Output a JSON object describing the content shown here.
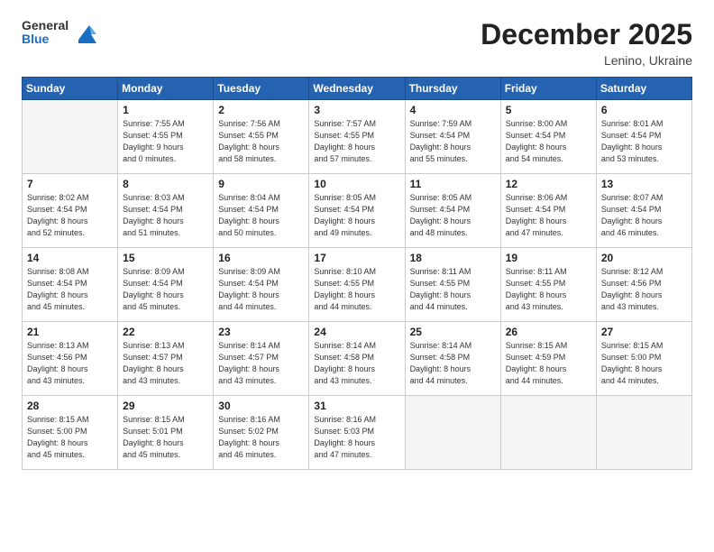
{
  "header": {
    "logo_line1": "General",
    "logo_line2": "Blue",
    "title": "December 2025",
    "location": "Lenino, Ukraine"
  },
  "weekdays": [
    "Sunday",
    "Monday",
    "Tuesday",
    "Wednesday",
    "Thursday",
    "Friday",
    "Saturday"
  ],
  "weeks": [
    [
      {
        "day": "",
        "info": ""
      },
      {
        "day": "1",
        "info": "Sunrise: 7:55 AM\nSunset: 4:55 PM\nDaylight: 9 hours\nand 0 minutes."
      },
      {
        "day": "2",
        "info": "Sunrise: 7:56 AM\nSunset: 4:55 PM\nDaylight: 8 hours\nand 58 minutes."
      },
      {
        "day": "3",
        "info": "Sunrise: 7:57 AM\nSunset: 4:55 PM\nDaylight: 8 hours\nand 57 minutes."
      },
      {
        "day": "4",
        "info": "Sunrise: 7:59 AM\nSunset: 4:54 PM\nDaylight: 8 hours\nand 55 minutes."
      },
      {
        "day": "5",
        "info": "Sunrise: 8:00 AM\nSunset: 4:54 PM\nDaylight: 8 hours\nand 54 minutes."
      },
      {
        "day": "6",
        "info": "Sunrise: 8:01 AM\nSunset: 4:54 PM\nDaylight: 8 hours\nand 53 minutes."
      }
    ],
    [
      {
        "day": "7",
        "info": "Sunrise: 8:02 AM\nSunset: 4:54 PM\nDaylight: 8 hours\nand 52 minutes."
      },
      {
        "day": "8",
        "info": "Sunrise: 8:03 AM\nSunset: 4:54 PM\nDaylight: 8 hours\nand 51 minutes."
      },
      {
        "day": "9",
        "info": "Sunrise: 8:04 AM\nSunset: 4:54 PM\nDaylight: 8 hours\nand 50 minutes."
      },
      {
        "day": "10",
        "info": "Sunrise: 8:05 AM\nSunset: 4:54 PM\nDaylight: 8 hours\nand 49 minutes."
      },
      {
        "day": "11",
        "info": "Sunrise: 8:05 AM\nSunset: 4:54 PM\nDaylight: 8 hours\nand 48 minutes."
      },
      {
        "day": "12",
        "info": "Sunrise: 8:06 AM\nSunset: 4:54 PM\nDaylight: 8 hours\nand 47 minutes."
      },
      {
        "day": "13",
        "info": "Sunrise: 8:07 AM\nSunset: 4:54 PM\nDaylight: 8 hours\nand 46 minutes."
      }
    ],
    [
      {
        "day": "14",
        "info": "Sunrise: 8:08 AM\nSunset: 4:54 PM\nDaylight: 8 hours\nand 45 minutes."
      },
      {
        "day": "15",
        "info": "Sunrise: 8:09 AM\nSunset: 4:54 PM\nDaylight: 8 hours\nand 45 minutes."
      },
      {
        "day": "16",
        "info": "Sunrise: 8:09 AM\nSunset: 4:54 PM\nDaylight: 8 hours\nand 44 minutes."
      },
      {
        "day": "17",
        "info": "Sunrise: 8:10 AM\nSunset: 4:55 PM\nDaylight: 8 hours\nand 44 minutes."
      },
      {
        "day": "18",
        "info": "Sunrise: 8:11 AM\nSunset: 4:55 PM\nDaylight: 8 hours\nand 44 minutes."
      },
      {
        "day": "19",
        "info": "Sunrise: 8:11 AM\nSunset: 4:55 PM\nDaylight: 8 hours\nand 43 minutes."
      },
      {
        "day": "20",
        "info": "Sunrise: 8:12 AM\nSunset: 4:56 PM\nDaylight: 8 hours\nand 43 minutes."
      }
    ],
    [
      {
        "day": "21",
        "info": "Sunrise: 8:13 AM\nSunset: 4:56 PM\nDaylight: 8 hours\nand 43 minutes."
      },
      {
        "day": "22",
        "info": "Sunrise: 8:13 AM\nSunset: 4:57 PM\nDaylight: 8 hours\nand 43 minutes."
      },
      {
        "day": "23",
        "info": "Sunrise: 8:14 AM\nSunset: 4:57 PM\nDaylight: 8 hours\nand 43 minutes."
      },
      {
        "day": "24",
        "info": "Sunrise: 8:14 AM\nSunset: 4:58 PM\nDaylight: 8 hours\nand 43 minutes."
      },
      {
        "day": "25",
        "info": "Sunrise: 8:14 AM\nSunset: 4:58 PM\nDaylight: 8 hours\nand 44 minutes."
      },
      {
        "day": "26",
        "info": "Sunrise: 8:15 AM\nSunset: 4:59 PM\nDaylight: 8 hours\nand 44 minutes."
      },
      {
        "day": "27",
        "info": "Sunrise: 8:15 AM\nSunset: 5:00 PM\nDaylight: 8 hours\nand 44 minutes."
      }
    ],
    [
      {
        "day": "28",
        "info": "Sunrise: 8:15 AM\nSunset: 5:00 PM\nDaylight: 8 hours\nand 45 minutes."
      },
      {
        "day": "29",
        "info": "Sunrise: 8:15 AM\nSunset: 5:01 PM\nDaylight: 8 hours\nand 45 minutes."
      },
      {
        "day": "30",
        "info": "Sunrise: 8:16 AM\nSunset: 5:02 PM\nDaylight: 8 hours\nand 46 minutes."
      },
      {
        "day": "31",
        "info": "Sunrise: 8:16 AM\nSunset: 5:03 PM\nDaylight: 8 hours\nand 47 minutes."
      },
      {
        "day": "",
        "info": ""
      },
      {
        "day": "",
        "info": ""
      },
      {
        "day": "",
        "info": ""
      }
    ]
  ]
}
